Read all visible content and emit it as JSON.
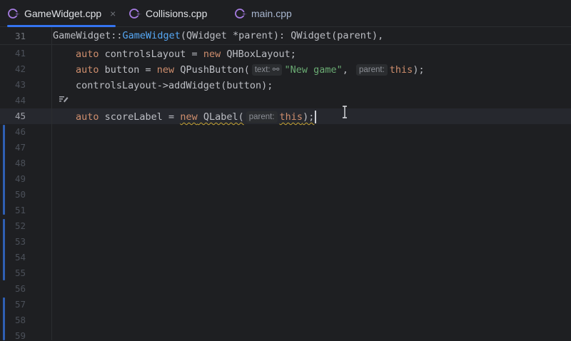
{
  "tabs": [
    {
      "label": "GameWidget.cpp",
      "close": "×",
      "icon": "cpp-file-icon"
    },
    {
      "label": "Collisions.cpp",
      "icon": "cpp-file-icon"
    },
    {
      "label": "main.cpp",
      "icon": "cpp-file-icon"
    }
  ],
  "sticky_header": {
    "line_number": "31",
    "class_name": "GameWidget",
    "scope": "::",
    "ctor_name": "GameWidget",
    "params": "(QWidget *parent): ",
    "init": "QWidget(parent),"
  },
  "line_numbers": [
    "41",
    "42",
    "43",
    "44",
    "45",
    "46",
    "47",
    "48",
    "49",
    "50",
    "51",
    "52",
    "53",
    "54",
    "55",
    "56",
    "57",
    "58",
    "59"
  ],
  "current_line": "45",
  "code": {
    "l41": {
      "kw": "auto",
      "rest": " controlsLayout = ",
      "kw2": "new",
      "cls": " QHBoxLayout;"
    },
    "l42": {
      "kw": "auto",
      "rest": " button = ",
      "kw2": "new",
      "fn": " QPushButton(",
      "hint_text": "text:",
      "str": "\"New game\"",
      "comma": ", ",
      "hint_parent": "parent:",
      "this": "this",
      "end": ");"
    },
    "l43": {
      "text": "controlsLayout->addWidget(button);"
    },
    "l45": {
      "kw": "auto",
      "rest": " scoreLabel = ",
      "kw2": "new",
      "fn": " QLabel(",
      "hint_parent": "parent:",
      "this": "this",
      "end": ");"
    }
  },
  "colors": {
    "accent": "#3574f0",
    "keyword": "#cf8e6d",
    "string": "#6aab73",
    "function": "#56a8f5"
  }
}
